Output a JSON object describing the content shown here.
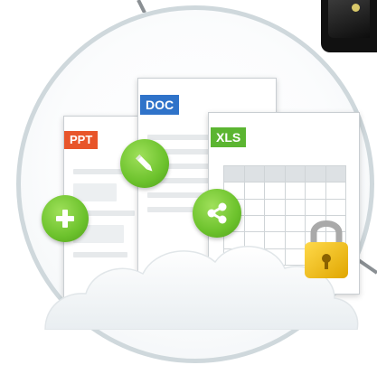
{
  "illustration": {
    "documents": [
      {
        "id": "ppt",
        "label": "PPT",
        "color": "#e8552a"
      },
      {
        "id": "doc",
        "label": "DOC",
        "color": "#2f73c9"
      },
      {
        "id": "xls",
        "label": "XLS",
        "color": "#5bb531"
      }
    ],
    "action_buttons": [
      {
        "id": "add",
        "icon": "plus-icon",
        "color": "#6cc22c"
      },
      {
        "id": "edit",
        "icon": "pencil-icon",
        "color": "#6cc22c"
      },
      {
        "id": "share",
        "icon": "share-icon",
        "color": "#6cc22c"
      }
    ],
    "security_icon": "padlock-icon",
    "cloud_icon": "cloud-icon",
    "ring_color": "#cfd8dc"
  }
}
